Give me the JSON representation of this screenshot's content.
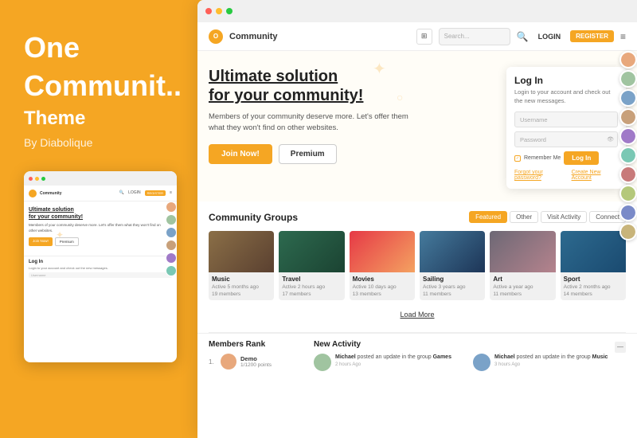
{
  "brand": {
    "title_line1": "One",
    "title_line2": "Communit..",
    "subtitle": "Theme",
    "by": "By Diabolique"
  },
  "browser": {
    "dots": [
      "red",
      "yellow",
      "green"
    ]
  },
  "nav": {
    "logo_letter": "O",
    "brand_name": "Community",
    "search_placeholder": "Search...",
    "login_label": "LOGIN",
    "register_label": "REGISTER"
  },
  "hero": {
    "title_line1": "Ultimate solution",
    "title_line2": "for your community!",
    "description": "Members of your community deserve more. Let's offer them what they won't find on other websites.",
    "join_btn": "Join Now!",
    "premium_btn": "Premium"
  },
  "login_box": {
    "title": "Log In",
    "description": "Login to your account and check out the new messages.",
    "username_placeholder": "Username",
    "password_placeholder": "Password",
    "remember_label": "Remember Me",
    "submit_label": "Log In",
    "forgot_label": "Forgot your password?",
    "create_label": "Create New Account"
  },
  "groups": {
    "section_title": "Community Groups",
    "filters": [
      "Featured",
      "Other",
      "Visit Activity",
      "Connect"
    ],
    "active_filter": 0,
    "load_more": "Load More",
    "items": [
      {
        "name": "Music",
        "meta1": "Active 5 months ago",
        "meta2": "19 members",
        "img_class": "img-music"
      },
      {
        "name": "Travel",
        "meta1": "Active 2 hours ago",
        "meta2": "17 members",
        "img_class": "img-travel"
      },
      {
        "name": "Movies",
        "meta1": "Active 10 days ago",
        "meta2": "13 members",
        "img_class": "img-movies"
      },
      {
        "name": "Sailing",
        "meta1": "Active 3 years ago",
        "meta2": "11 members",
        "img_class": "img-sailing"
      },
      {
        "name": "Art",
        "meta1": "Active a year ago",
        "meta2": "11 members",
        "img_class": "img-art"
      },
      {
        "name": "Sport",
        "meta1": "Active 2 months ago",
        "meta2": "14 members",
        "img_class": "img-sport"
      }
    ]
  },
  "members_rank": {
    "title": "Members Rank",
    "items": [
      {
        "rank": "1.",
        "name": "Demo",
        "points": "1/1200 points",
        "av": "av1"
      }
    ]
  },
  "new_activity": {
    "title": "New Activity",
    "items": [
      {
        "text": "Michael posted an update in the group Games",
        "time": "2 hours Ago",
        "av": "av2"
      },
      {
        "text": "Michael posted an update in the group Music",
        "time": "3 hours Ago",
        "av": "av3"
      }
    ]
  },
  "avatar_strip": [
    {
      "av": "av1"
    },
    {
      "av": "av2"
    },
    {
      "av": "av3"
    },
    {
      "av": "av4"
    },
    {
      "av": "av5"
    },
    {
      "av": "av6"
    },
    {
      "av": "av7"
    },
    {
      "av": "av8"
    },
    {
      "av": "av9"
    },
    {
      "av": "av10"
    }
  ],
  "preview_avatars": [
    {
      "av": "av2"
    },
    {
      "av": "av3"
    },
    {
      "av": "av4"
    },
    {
      "av": "av5"
    },
    {
      "av": "av6"
    },
    {
      "av": "av7"
    }
  ]
}
